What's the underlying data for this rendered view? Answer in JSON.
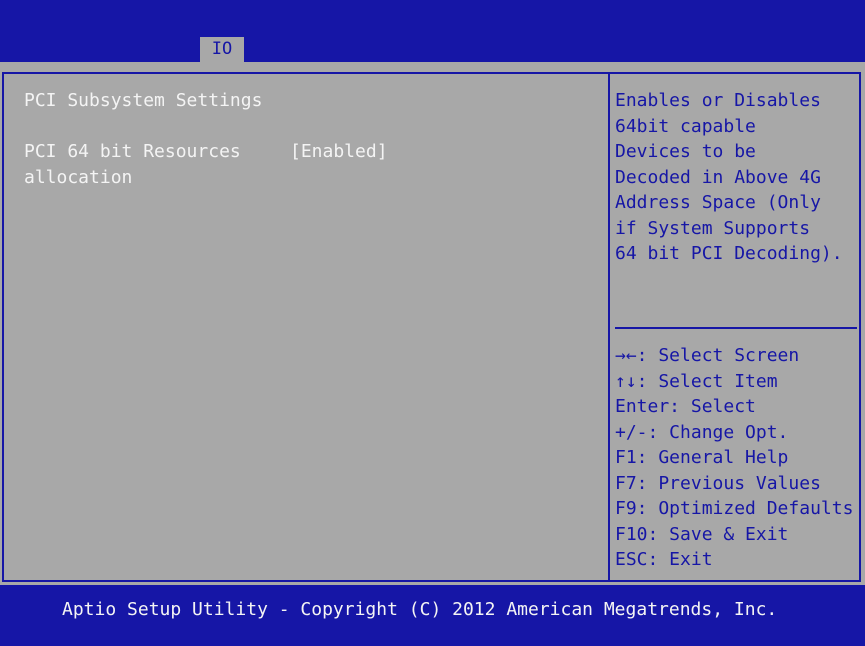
{
  "tabs": [
    {
      "label": "IO"
    }
  ],
  "main": {
    "section_title": "PCI Subsystem Settings",
    "setting": {
      "label_line1": "PCI 64 bit Resources",
      "label_line2": "allocation",
      "value": "[Enabled]"
    }
  },
  "help": {
    "lines": [
      "Enables or Disables",
      "64bit capable",
      "Devices to be",
      "Decoded in Above 4G",
      "Address Space (Only",
      "if System Supports",
      "64 bit PCI Decoding)."
    ]
  },
  "keys": [
    "→←: Select Screen",
    "↑↓: Select Item",
    "Enter: Select",
    "+/-: Change Opt.",
    "F1: General Help",
    "F7: Previous Values",
    "F9: Optimized Defaults",
    "F10: Save & Exit",
    "ESC: Exit"
  ],
  "footer": {
    "text": "Aptio Setup Utility - Copyright (C) 2012 American Megatrends, Inc."
  },
  "colors": {
    "background_blue": "#1616a6",
    "panel_gray": "#a8a8a8",
    "text_white": "#f4f4f4"
  }
}
